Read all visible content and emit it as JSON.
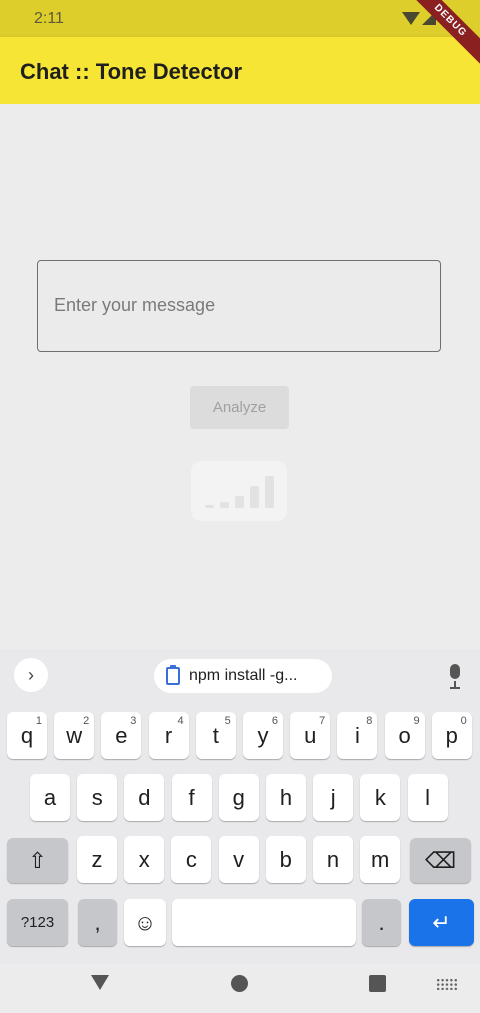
{
  "status_bar": {
    "time": "2:11",
    "debug_label": "DEBUG"
  },
  "app_bar": {
    "title": "Chat :: Tone Detector"
  },
  "form": {
    "message_placeholder": "Enter your message",
    "message_value": "",
    "analyze_label": "Analyze"
  },
  "keyboard": {
    "expand_icon": "›",
    "clipboard_suggestion": "npm install -g...",
    "row1": [
      {
        "key": "q",
        "num": "1"
      },
      {
        "key": "w",
        "num": "2"
      },
      {
        "key": "e",
        "num": "3"
      },
      {
        "key": "r",
        "num": "4"
      },
      {
        "key": "t",
        "num": "5"
      },
      {
        "key": "y",
        "num": "6"
      },
      {
        "key": "u",
        "num": "7"
      },
      {
        "key": "i",
        "num": "8"
      },
      {
        "key": "o",
        "num": "9"
      },
      {
        "key": "p",
        "num": "0"
      }
    ],
    "row2": [
      "a",
      "s",
      "d",
      "f",
      "g",
      "h",
      "j",
      "k",
      "l"
    ],
    "row3": [
      "z",
      "x",
      "c",
      "v",
      "b",
      "n",
      "m"
    ],
    "symbols_label": "?123",
    "comma_label": ",",
    "emoji_label": "☺",
    "period_label": ".",
    "shift_icon": "⇧",
    "backspace_icon": "⌫",
    "enter_icon": "↵"
  },
  "icons": {
    "wifi": "wifi-icon",
    "signal": "cell-signal-icon",
    "clipboard": "clipboard-icon",
    "mic": "microphone-icon",
    "loading": "signal-bars-loading-icon"
  },
  "colors": {
    "app_bar": "#f6e534",
    "status_bar": "#ddce2c",
    "enter_key": "#1a73e8"
  }
}
